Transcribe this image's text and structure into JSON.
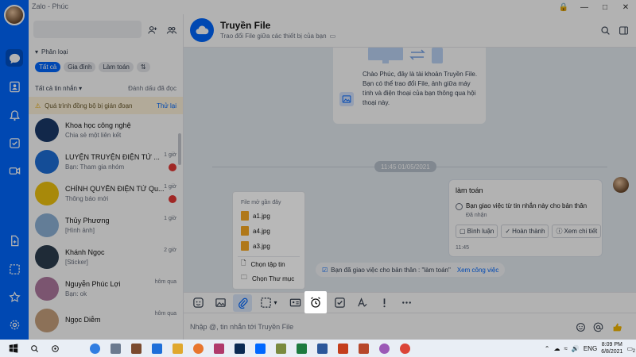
{
  "window": {
    "title": "Zalo - Phúc"
  },
  "sidebar": {
    "category_label": "Phân loại",
    "chips": [
      "Tất cả",
      "Gia đình",
      "Làm toán"
    ],
    "filter_label": "Tất cả tin nhắn",
    "filter_action": "Đánh dấu đã đọc",
    "banner_text": "Quá trình đồng bộ bị gián đoạn",
    "banner_link": "Thử lại",
    "conversations": [
      {
        "name": "Khoa học công nghệ",
        "preview": "Chia sẻ một liên kết",
        "time": "",
        "color": "#1a3a6b"
      },
      {
        "name": "LUYỆN TRUYỆN ĐIỆN TỬ ...",
        "preview": "Bạn: Tham gia nhóm",
        "time": "1 giờ",
        "color": "#1e6fd9"
      },
      {
        "name": "CHÍNH QUYỀN ĐIỆN TỬ Qu...",
        "preview": "Thông báo mới",
        "time": "1 giờ",
        "color": "#f1c40f"
      },
      {
        "name": "Thủy Phương",
        "preview": "[Hình ảnh]",
        "time": "1 giờ",
        "color": "#8fb3d9"
      },
      {
        "name": "Khánh Ngọc",
        "preview": "[Sticker]",
        "time": "2 giờ",
        "color": "#2d3e50"
      },
      {
        "name": "Nguyễn Phúc Lợi",
        "preview": "Bạn: ok",
        "time": "hôm qua",
        "color": "#b07aa1"
      },
      {
        "name": "Ngọc Diễm",
        "preview": "",
        "time": "hôm qua",
        "color": "#c9a27e"
      }
    ]
  },
  "chat": {
    "title": "Truyền File",
    "subtitle": "Trao đổi File giữa các thiết bị của bạn",
    "intro_text": "Chào Phúc, đây là tài khoản Truyền File. Bạn có thể trao đổi File, ảnh giữa máy tính và điện thoại của bạn thông qua hội thoại này.",
    "date_separator": "11:45 01/05/2021",
    "task": {
      "title": "làm toán",
      "description": "Bạn giao việc từ tin nhắn này cho bản thân",
      "status": "Đã nhận",
      "comment": "Bình luận",
      "complete": "Hoàn thành",
      "details": "Xem chi tiết",
      "time": "11:45"
    },
    "notice_text": "Bạn đã giao việc cho bản thân : \"làm toán\"",
    "notice_link": "Xem công việc",
    "input_placeholder": "Nhập @, tin nhắn tới Truyền File"
  },
  "attach_menu": {
    "header": "File mở gần đây",
    "files": [
      "a1.jpg",
      "a4.jpg",
      "a3.jpg"
    ],
    "choose_file": "Chọn tập tin",
    "choose_folder": "Chọn Thư mục"
  },
  "taskbar": {
    "lang": "ENG",
    "time": "8:09 PM",
    "date": "6/8/2021",
    "notif_count": "2"
  }
}
